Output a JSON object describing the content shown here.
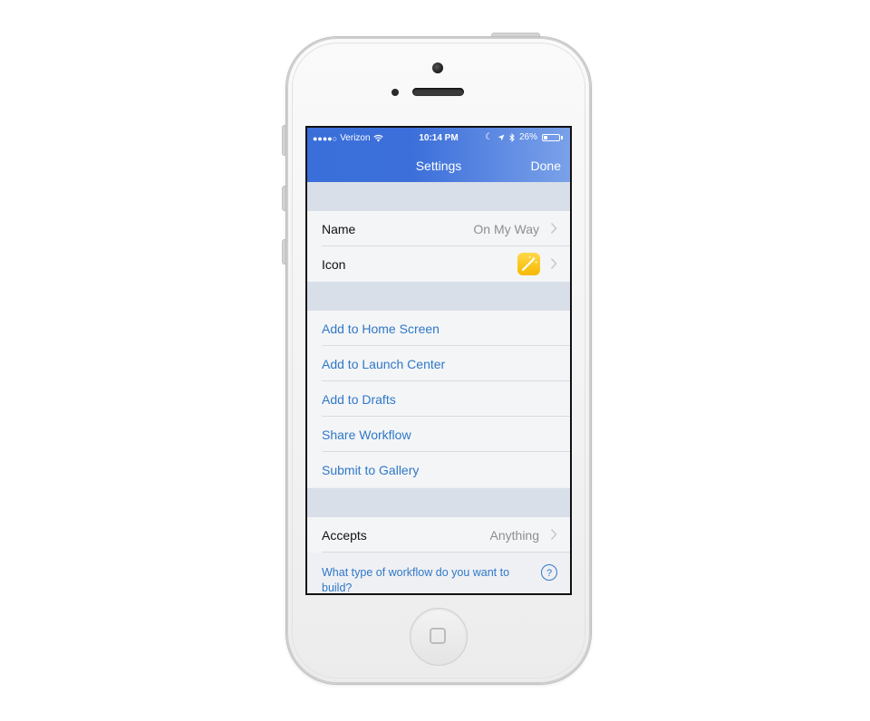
{
  "status_bar": {
    "carrier": "Verizon",
    "time": "10:14 PM",
    "battery": "26%",
    "battery_level": 0.26
  },
  "nav": {
    "title": "Settings",
    "done_label": "Done"
  },
  "settings": {
    "name_label": "Name",
    "name_value": "On My Way",
    "icon_label": "Icon"
  },
  "actions": [
    {
      "label": "Add to Home Screen"
    },
    {
      "label": "Add to Launch Center"
    },
    {
      "label": "Add to Drafts"
    },
    {
      "label": "Share Workflow"
    },
    {
      "label": "Submit to Gallery"
    }
  ],
  "accepts": {
    "label": "Accepts",
    "value": "Anything"
  },
  "help": {
    "text": "What type of workflow do you want to build?",
    "icon": "?"
  },
  "colors": {
    "nav_blue": "#3a6fd9",
    "action_blue": "#2f78c8",
    "icon_yellow": "#f7b900"
  }
}
